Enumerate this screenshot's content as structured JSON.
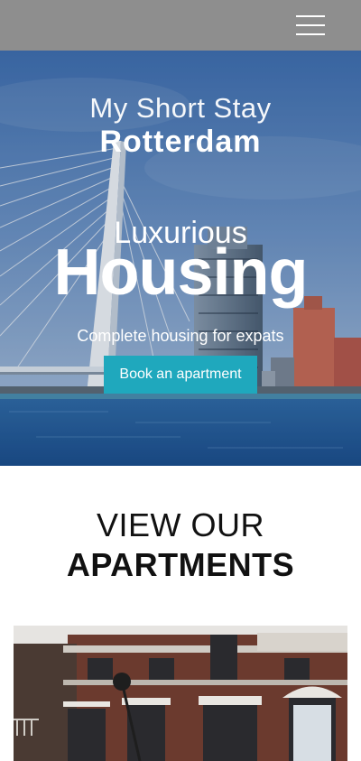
{
  "nav": {
    "menu_icon": "hamburger-menu-icon"
  },
  "hero": {
    "logo_line1": "My Short Stay",
    "logo_line2": "Rotterdam",
    "eyebrow": "Luxurious",
    "title": "Housing",
    "subtitle": "Complete housing for expats",
    "cta_label": "Book an apartment"
  },
  "section": {
    "heading_line1": "VIEW OUR",
    "heading_line2": "APARTMENTS"
  },
  "colors": {
    "topbar": "#8e8e8e",
    "accent": "#1fa8bd",
    "text_dark": "#111111"
  }
}
